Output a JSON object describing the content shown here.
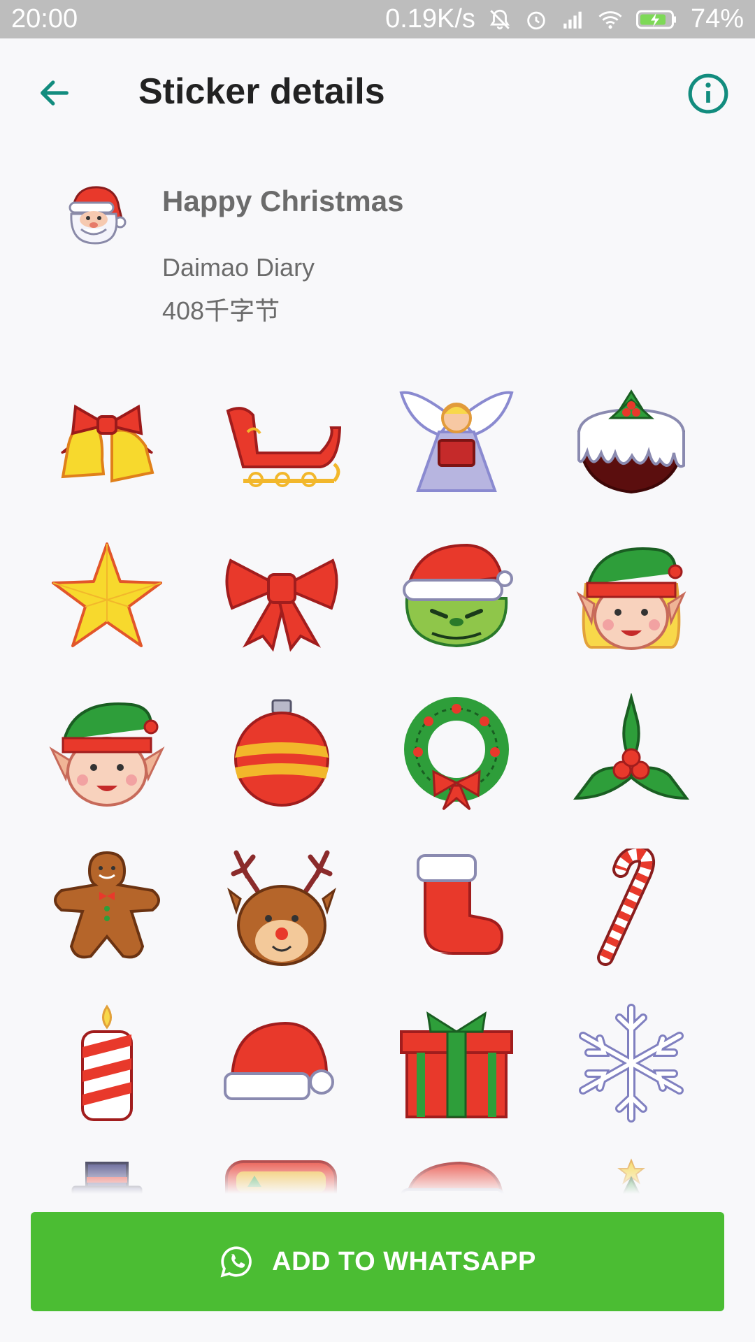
{
  "status_bar": {
    "time": "20:00",
    "net_speed": "0.19K/s",
    "battery": "74%"
  },
  "app_bar": {
    "title": "Sticker details"
  },
  "pack": {
    "name": "Happy Christmas",
    "publisher": "Daimao Diary",
    "size": "408千字节",
    "tray_icon": "santa-face"
  },
  "stickers": [
    "bells",
    "sleigh",
    "angel",
    "christmas-pudding",
    "star",
    "red-bow",
    "grinch-with-santa-hat",
    "elf-girl",
    "elf-boy",
    "red-ornament-ball",
    "wreath",
    "holly",
    "gingerbread-man",
    "reindeer",
    "stocking",
    "candy-cane",
    "candle",
    "santa-hat",
    "gift-box",
    "snowflake",
    "snowman",
    "sled-sign",
    "santa-hat-small",
    "christmas-tree"
  ],
  "actions": {
    "add_to_whatsapp": "ADD TO WHATSAPP"
  },
  "colors": {
    "accent": "#128c7e",
    "button": "#4bbd33",
    "status_bar": "#bdbdbd"
  }
}
